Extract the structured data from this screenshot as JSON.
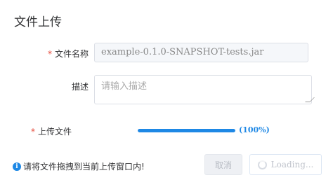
{
  "dialog": {
    "title": "文件上传"
  },
  "form": {
    "required_mark": "*",
    "file_name": {
      "label": "文件名称",
      "value": "example-0.1.0-SNAPSHOT-tests.jar"
    },
    "description": {
      "label": "描述",
      "placeholder": "请输入描述"
    },
    "upload": {
      "label": "上传文件",
      "progress_percent": 100,
      "progress_text": "(100%)"
    }
  },
  "footer": {
    "tip_icon": "info-icon",
    "tip_text": "请将文件拖拽到当前上传窗口内!",
    "cancel_label": "取消",
    "loading_label": "Loading..."
  },
  "colors": {
    "accent": "#1e88e5",
    "required": "#e64a3b"
  }
}
